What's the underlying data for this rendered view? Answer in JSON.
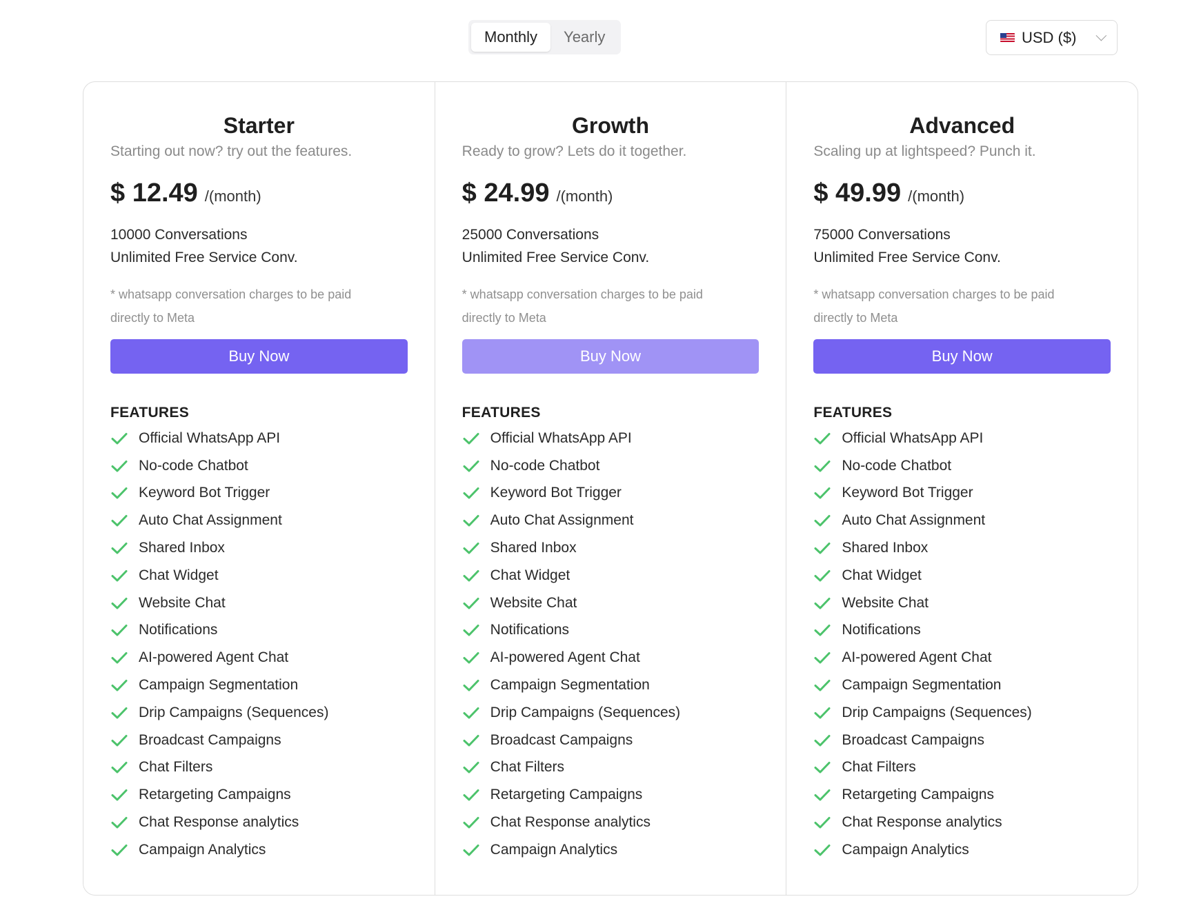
{
  "billing": {
    "options": [
      "Monthly",
      "Yearly"
    ],
    "selected": "Monthly"
  },
  "currency": {
    "flag_icon": "us-flag-icon",
    "label": "USD ($)"
  },
  "colors": {
    "accent": "#7563f1",
    "accent_light": "#a093f5",
    "check": "#4cc36b"
  },
  "features_heading": "FEATURES",
  "plans": [
    {
      "name": "Starter",
      "tagline": "Starting out now? try out the features.",
      "price": "$ 12.49",
      "period": "/(month)",
      "conversations": "10000 Conversations",
      "service": "Unlimited Free Service Conv.",
      "note": "* whatsapp conversation charges to be paid directly to Meta",
      "button": "Buy Now",
      "button_style": "solid",
      "features": [
        "Official WhatsApp API",
        "No-code Chatbot",
        "Keyword Bot Trigger",
        "Auto Chat Assignment",
        "Shared Inbox",
        "Chat Widget",
        "Website Chat",
        "Notifications",
        "AI-powered Agent Chat",
        "Campaign Segmentation",
        "Drip Campaigns (Sequences)",
        "Broadcast Campaigns",
        "Chat Filters",
        "Retargeting Campaigns",
        "Chat Response analytics",
        "Campaign Analytics"
      ]
    },
    {
      "name": "Growth",
      "tagline": "Ready to grow? Lets do it together.",
      "price": "$ 24.99",
      "period": "/(month)",
      "conversations": "25000 Conversations",
      "service": "Unlimited Free Service Conv.",
      "note": "* whatsapp conversation charges to be paid directly to Meta",
      "button": "Buy Now",
      "button_style": "light",
      "features": [
        "Official WhatsApp API",
        "No-code Chatbot",
        "Keyword Bot Trigger",
        "Auto Chat Assignment",
        "Shared Inbox",
        "Chat Widget",
        "Website Chat",
        "Notifications",
        "AI-powered Agent Chat",
        "Campaign Segmentation",
        "Drip Campaigns (Sequences)",
        "Broadcast Campaigns",
        "Chat Filters",
        "Retargeting Campaigns",
        "Chat Response analytics",
        "Campaign Analytics"
      ]
    },
    {
      "name": "Advanced",
      "tagline": "Scaling up at lightspeed? Punch it.",
      "price": "$ 49.99",
      "period": "/(month)",
      "conversations": "75000 Conversations",
      "service": "Unlimited Free Service Conv.",
      "note": "* whatsapp conversation charges to be paid directly to Meta",
      "button": "Buy Now",
      "button_style": "solid",
      "features": [
        "Official WhatsApp API",
        "No-code Chatbot",
        "Keyword Bot Trigger",
        "Auto Chat Assignment",
        "Shared Inbox",
        "Chat Widget",
        "Website Chat",
        "Notifications",
        "AI-powered Agent Chat",
        "Campaign Segmentation",
        "Drip Campaigns (Sequences)",
        "Broadcast Campaigns",
        "Chat Filters",
        "Retargeting Campaigns",
        "Chat Response analytics",
        "Campaign Analytics"
      ]
    }
  ]
}
